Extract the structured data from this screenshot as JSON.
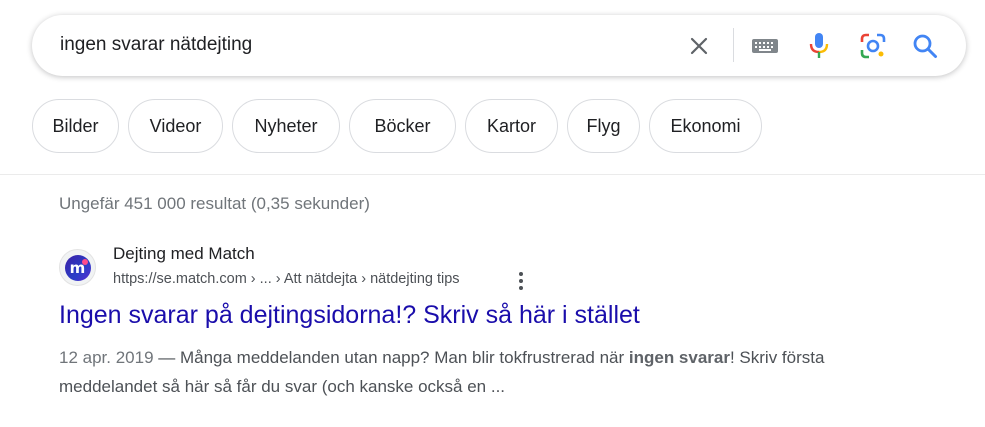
{
  "search": {
    "query": "ingen svarar nätdejting"
  },
  "tabs": [
    {
      "label": "Bilder"
    },
    {
      "label": "Videor"
    },
    {
      "label": "Nyheter"
    },
    {
      "label": "Böcker"
    },
    {
      "label": "Kartor"
    },
    {
      "label": "Flyg"
    },
    {
      "label": "Ekonomi"
    }
  ],
  "results_stats": "Ungefär 451 000 resultat (0,35 sekunder)",
  "result": {
    "site_name": "Dejting med Match",
    "url": "https://se.match.com › ... › Att nätdejta › nätdejting tips",
    "title": "Ingen svarar på dejtingsidorna!? Skriv så här i stället",
    "date": "12 apr. 2019",
    "snippet_part1": " — Många meddelanden utan napp? Man blir tokfrustrerad när ",
    "snippet_bold": "ingen svarar",
    "snippet_part2": "! Skriv första meddelandet så här så får du svar (och kanske också en ..."
  },
  "icons": {
    "clear": "close-icon",
    "keyboard": "keyboard-icon",
    "voice": "microphone-icon",
    "lens": "lens-camera-icon",
    "search": "search-icon",
    "favicon": "match-favicon",
    "more": "more-vert-icon"
  },
  "colors": {
    "link": "#1a0dab",
    "mic_blue": "#4285f4",
    "mic_red": "#ea4335",
    "mic_yellow": "#fbbc04",
    "mic_green": "#34a853"
  }
}
